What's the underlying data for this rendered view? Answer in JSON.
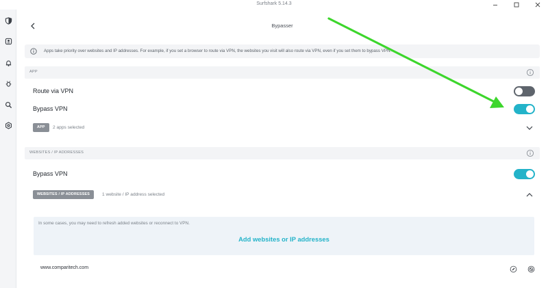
{
  "window": {
    "title": "Surfshark 5.14.3",
    "controls": {
      "minimize": "—",
      "maximize": "☐",
      "close": "✕"
    }
  },
  "sidebar": {
    "items": [
      {
        "name": "vpn",
        "icon": "shield-icon"
      },
      {
        "name": "alert",
        "icon": "alert-icon"
      },
      {
        "name": "antivirus",
        "icon": "bell-icon"
      },
      {
        "name": "bug",
        "icon": "bug-icon"
      },
      {
        "name": "search",
        "icon": "search-icon"
      },
      {
        "name": "settings",
        "icon": "gear-icon"
      }
    ]
  },
  "header": {
    "title": "Bypasser"
  },
  "info_banner": {
    "text": "Apps take priority over websites and IP addresses. For example, if you set a browser to route via VPN, the websites you visit will also route via VPN, even if you set them to bypass VPN."
  },
  "app_section": {
    "header": "APP",
    "route_label": "Route via VPN",
    "route_on": false,
    "bypass_label": "Bypass VPN",
    "bypass_on": true,
    "tag": "APP",
    "selected_text": "2 apps selected"
  },
  "web_section": {
    "header": "WEBSITES / IP ADDRESSES",
    "bypass_label": "Bypass VPN",
    "bypass_on": true,
    "tag": "WEBSITES / IP ADDRESSES",
    "selected_text": "1 website / IP address selected",
    "note": "In some cases, you may need to refresh added websites or reconnect to VPN.",
    "add_label": "Add websites or IP addresses",
    "sites": [
      {
        "url": "www.comparitech.com"
      }
    ]
  },
  "colors": {
    "accent": "#23b3c9",
    "toggle_off": "#5e646c",
    "annotation_arrow": "#3dd62c"
  }
}
